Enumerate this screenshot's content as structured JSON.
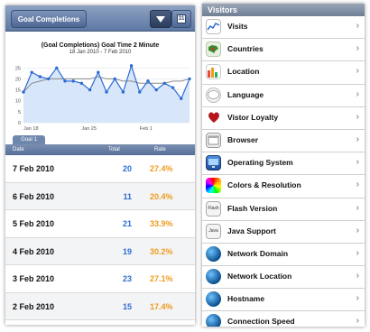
{
  "left": {
    "nav": {
      "back_label": "Goal Completions",
      "calendar_glyph": "31"
    },
    "chart": {
      "title": "(Goal Completions) Goal Time 2 Minute",
      "subtitle": "18 Jan 2010 - 7 Feb 2010"
    },
    "tab_label": "Goal 1",
    "table": {
      "headers": {
        "date": "Date",
        "total": "Total",
        "rate": "Rate"
      },
      "rows": [
        {
          "date": "7 Feb 2010",
          "total": "20",
          "rate": "27.4%"
        },
        {
          "date": "6 Feb 2010",
          "total": "11",
          "rate": "20.4%"
        },
        {
          "date": "5 Feb 2010",
          "total": "21",
          "rate": "33.9%"
        },
        {
          "date": "4 Feb 2010",
          "total": "19",
          "rate": "30.2%"
        },
        {
          "date": "3 Feb 2010",
          "total": "23",
          "rate": "27.1%"
        },
        {
          "date": "2 Feb 2010",
          "total": "15",
          "rate": "17.4%"
        }
      ]
    }
  },
  "right": {
    "header": "Visitors",
    "items": [
      {
        "label": "Visits",
        "icon": "visits-icon"
      },
      {
        "label": "Countries",
        "icon": "countries-icon"
      },
      {
        "label": "Location",
        "icon": "location-icon"
      },
      {
        "label": "Language",
        "icon": "language-icon"
      },
      {
        "label": "Vistor Loyalty",
        "icon": "heart-icon"
      },
      {
        "label": "Browser",
        "icon": "browser-icon"
      },
      {
        "label": "Operating System",
        "icon": "monitor-icon"
      },
      {
        "label": "Colors & Resolution",
        "icon": "color-wheel-icon"
      },
      {
        "label": "Flash Version",
        "icon": "flash-icon"
      },
      {
        "label": "Java Support",
        "icon": "java-icon"
      },
      {
        "label": "Network Domain",
        "icon": "globe-icon"
      },
      {
        "label": "Network Location",
        "icon": "globe-icon"
      },
      {
        "label": "Hostname",
        "icon": "globe-icon"
      },
      {
        "label": "Connection Speed",
        "icon": "globe-icon"
      }
    ],
    "chevron": "›"
  },
  "chart_data": {
    "type": "line",
    "title": "(Goal Completions) Goal Time 2 Minute",
    "subtitle": "18 Jan 2010 - 7 Feb 2010",
    "x_tick_labels": [
      "Jan 18",
      "Jan 25",
      "Feb 1"
    ],
    "y_tick_labels": [
      "0",
      "5",
      "10",
      "15",
      "20",
      "25"
    ],
    "ylim": [
      0,
      28
    ],
    "x": [
      "Jan 18",
      "Jan 19",
      "Jan 20",
      "Jan 21",
      "Jan 22",
      "Jan 23",
      "Jan 24",
      "Jan 25",
      "Jan 26",
      "Jan 27",
      "Jan 28",
      "Jan 29",
      "Jan 30",
      "Jan 31",
      "Feb 1",
      "Feb 2",
      "Feb 3",
      "Feb 4",
      "Feb 5",
      "Feb 6",
      "Feb 7"
    ],
    "series": [
      {
        "values": [
          14,
          23,
          21,
          20,
          25,
          19,
          19,
          18,
          15,
          23,
          14,
          20,
          14,
          26,
          14,
          19,
          15,
          18,
          16,
          11,
          20
        ]
      },
      {
        "values": [
          14,
          18,
          19,
          20,
          20,
          20,
          20,
          20,
          20,
          21,
          20,
          20,
          19,
          19,
          18,
          18,
          18,
          18,
          19,
          19,
          20
        ]
      }
    ],
    "colors": {
      "primary": "#2c6cd6",
      "secondary": "#888888",
      "fill": "#d7e6f8"
    },
    "grid": true
  },
  "colors": {
    "accent_blue": "#2c6cd6",
    "rate_orange": "#f09b1e",
    "nav_blue": "#6f87ad"
  }
}
